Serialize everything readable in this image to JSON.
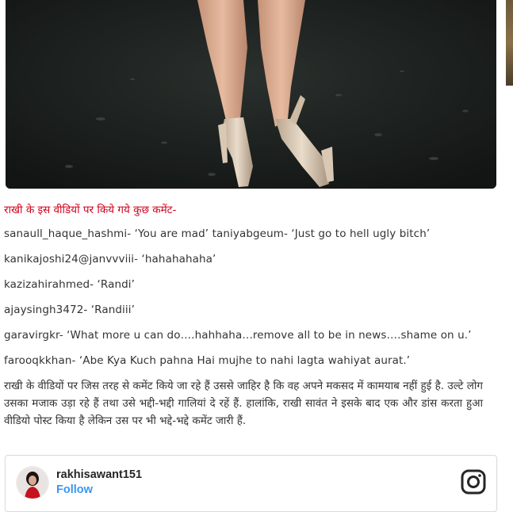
{
  "intro_text": "राखी के इस वीडियों पर किये गये कुछ कमेंट-",
  "comments": [
    "sanaull_haque_hashmi- ‘You are mad’ taniyabgeum- ‘Just go to hell ugly bitch’",
    "kanikajoshi24@janvvviii- ‘hahahahaha’",
    "kazizahirahmed- ‘Randi’",
    "ajaysingh3472- ‘Randiii’",
    "garavirgkr- ‘What more u can do….hahhaha…remove all to be in news….shame on u.’",
    "farooqkkhan- ‘Abe Kya Kuch pahna Hai mujhe to nahi lagta wahiyat aurat.’"
  ],
  "paragraph": "राखी के वीडियों पर जिस तरह से कमेंट किये जा रहे हैं उससे जाहिर है कि वह अपने मकसद में कामयाब नहीं हुई है. उल्टे लोग उसका मजाक उड़ा रहे हैं तथा उसे भद्दी-भद्दी गालियां दे रहें हैं. हालांकि, राखी सावंत ने इसके बाद एक और डांस करता हुआ वीडियो पोस्ट किया है लेकिन उस पर भी भद्दे-भद्दे कमेंट जारी हैं.",
  "embed": {
    "username": "rakhisawant151",
    "follow_label": "Follow",
    "icon": "instagram-icon",
    "follow_color": "#3897f0"
  },
  "colors": {
    "intro": "#d0021b",
    "text": "#333333"
  }
}
